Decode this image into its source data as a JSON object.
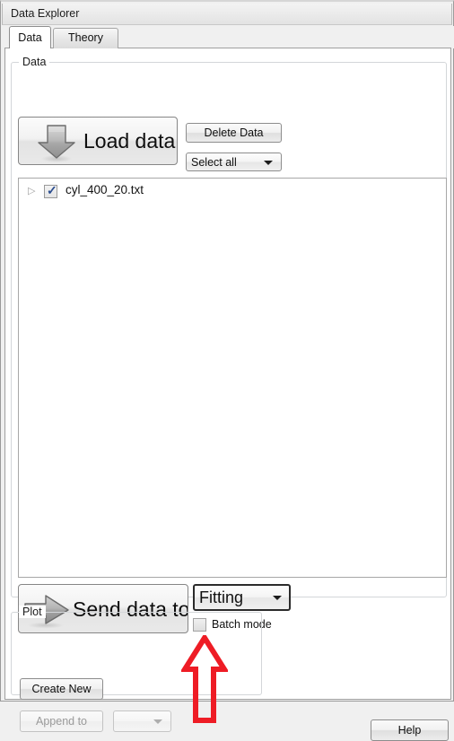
{
  "window": {
    "title": "Data Explorer"
  },
  "tabs": [
    {
      "label": "Data",
      "active": true
    },
    {
      "label": "Theory",
      "active": false
    }
  ],
  "data_group": {
    "title": "Data",
    "load_button": {
      "label": "Load data",
      "icon": "arrow-down-icon"
    },
    "delete_button": {
      "label": "Delete Data"
    },
    "select_combo": {
      "value": "Select all",
      "caret": "chevron-down-icon"
    },
    "file_list": {
      "columns": [],
      "rows": [
        {
          "name": "cyl_400_20.txt",
          "checked": true,
          "expander": "triangle-right-icon"
        }
      ]
    },
    "send_button": {
      "label": "Send data to",
      "icon": "arrow-right-icon"
    },
    "destination_combo": {
      "value": "Fitting",
      "caret": "chevron-down-icon",
      "highlight_color": "#2b2b2b"
    },
    "batch_mode": {
      "label": "Batch mode",
      "checked": false
    }
  },
  "plot_group": {
    "title": "Plot",
    "create_new_button": {
      "label": "Create New",
      "disabled": false
    },
    "append_to_button": {
      "label": "Append to",
      "disabled": true
    },
    "append_combo": {
      "value": "",
      "disabled": true,
      "caret": "chevron-down-icon"
    }
  },
  "help_button": {
    "label": "Help"
  },
  "annotation": {
    "arrow": {
      "icon": "arrow-up-outline-icon",
      "color": "#ee1c25",
      "points_to": "batch-mode-checkbox"
    }
  },
  "colors": {
    "window_bg": "#f0f0f0",
    "panel_bg": "#ffffff",
    "border": "#9f9f9f",
    "annotation_red": "#ee1c25",
    "checkmark_blue": "#2b4d8f"
  }
}
